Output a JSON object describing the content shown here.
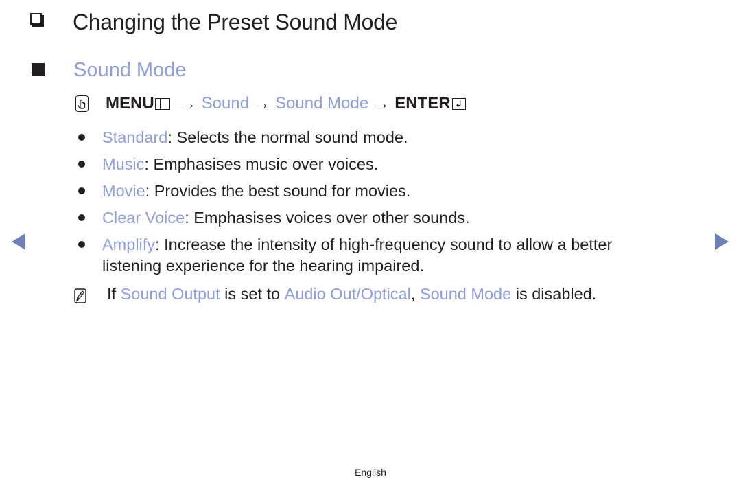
{
  "title": "Changing the Preset Sound Mode",
  "section": {
    "heading": "Sound Mode"
  },
  "menu_path": {
    "menu_label": "MENU",
    "arrow": "→",
    "steps": [
      "Sound",
      "Sound Mode"
    ],
    "enter_label": "ENTER",
    "enter_glyph": "↲"
  },
  "options": [
    {
      "name": "Standard",
      "sep": ": ",
      "description": "Selects the normal sound mode."
    },
    {
      "name": "Music",
      "sep": ": ",
      "description": "Emphasises music over voices."
    },
    {
      "name": "Movie",
      "sep": ": ",
      "description": "Provides the best sound for movies."
    },
    {
      "name": "Clear Voice",
      "sep": ": ",
      "description": "Emphasises voices over other sounds."
    },
    {
      "name": "Amplify",
      "sep": ": ",
      "description": "Increase the intensity of high-frequency sound to allow a better listening experience for the hearing impaired."
    }
  ],
  "note": {
    "prefix": "If ",
    "term1": "Sound Output",
    "mid1": " is set to ",
    "term2": "Audio Out/Optical",
    "mid2": ", ",
    "term3": "Sound Mode",
    "suffix": " is disabled."
  },
  "nav": {
    "prev_icon": "triangle-left-icon",
    "next_icon": "triangle-right-icon"
  },
  "footer": {
    "language": "English"
  },
  "colors": {
    "accent_text": "#8e9ee0",
    "nav_arrow": "#6e80b8",
    "body_text": "#231f20"
  }
}
